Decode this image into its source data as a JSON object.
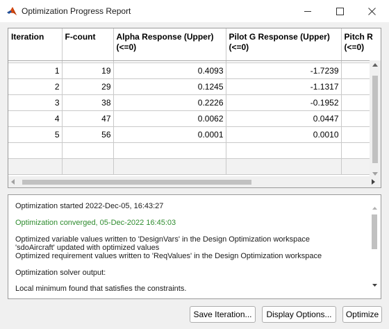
{
  "window": {
    "title": "Optimization Progress Report",
    "controls": {
      "minimize": "minimize",
      "maximize": "maximize",
      "close": "close"
    }
  },
  "table": {
    "headers": [
      {
        "line1": "Iteration",
        "line2": ""
      },
      {
        "line1": "F-count",
        "line2": ""
      },
      {
        "line1": "Alpha Response (Upper)",
        "line2": "(<=0)"
      },
      {
        "line1": "Pilot G Response (Upper)",
        "line2": "(<=0)"
      },
      {
        "line1": "Pitch R",
        "line2": "(<=0)"
      }
    ],
    "rows": [
      {
        "iteration": "1",
        "fcount": "19",
        "alpha": "0.4093",
        "pilot": "-1.7239",
        "pitch": ""
      },
      {
        "iteration": "2",
        "fcount": "29",
        "alpha": "0.1245",
        "pilot": "-1.1317",
        "pitch": ""
      },
      {
        "iteration": "3",
        "fcount": "38",
        "alpha": "0.2226",
        "pilot": "-0.1952",
        "pitch": ""
      },
      {
        "iteration": "4",
        "fcount": "47",
        "alpha": "0.0062",
        "pilot": "0.0447",
        "pitch": ""
      },
      {
        "iteration": "5",
        "fcount": "56",
        "alpha": "0.0001",
        "pilot": "0.0010",
        "pitch": ""
      }
    ]
  },
  "log": {
    "started": "Optimization started 2022-Dec-05, 16:43:27",
    "converged": "Optimization converged, 05-Dec-2022 16:45:03",
    "written_vars": "Optimized variable values written to 'DesignVars' in the Design Optimization workspace",
    "updated_model": "'sdoAircraft' updated with optimized values",
    "written_req": "Optimized requirement values written to 'ReqValues' in the Design Optimization workspace",
    "solver_output": "Optimization solver output:",
    "local_min": "Local minimum found that satisfies the constraints."
  },
  "buttons": {
    "save_iteration": "Save Iteration...",
    "display_options": "Display Options...",
    "optimize": "Optimize"
  },
  "colors": {
    "converged_text": "#2e8b2e",
    "matlab_icon_primary": "#d9480f",
    "matlab_icon_secondary": "#1f4f9a"
  }
}
